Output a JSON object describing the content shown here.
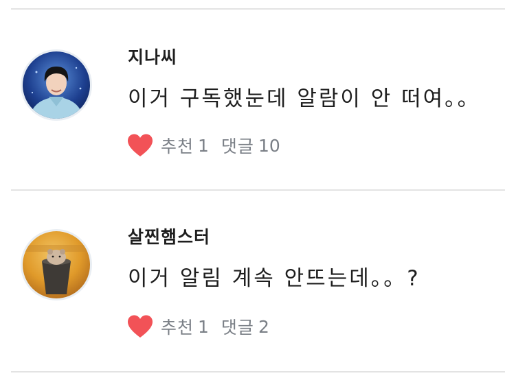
{
  "comments": [
    {
      "username": "지나씨",
      "text": "이거 구독했눈데 알람이 안 떠여。。",
      "like_label": "추천",
      "like_count": "1",
      "reply_label": "댓글",
      "reply_count": "10"
    },
    {
      "username": "살찐햄스터",
      "text": "이거 알림 계속 안뜨는데。。?",
      "like_label": "추천",
      "like_count": "1",
      "reply_label": "댓글",
      "reply_count": "2"
    }
  ],
  "colors": {
    "heart": "#f25257",
    "divider": "#e3e3e3",
    "meta_text": "#7a7f86"
  }
}
